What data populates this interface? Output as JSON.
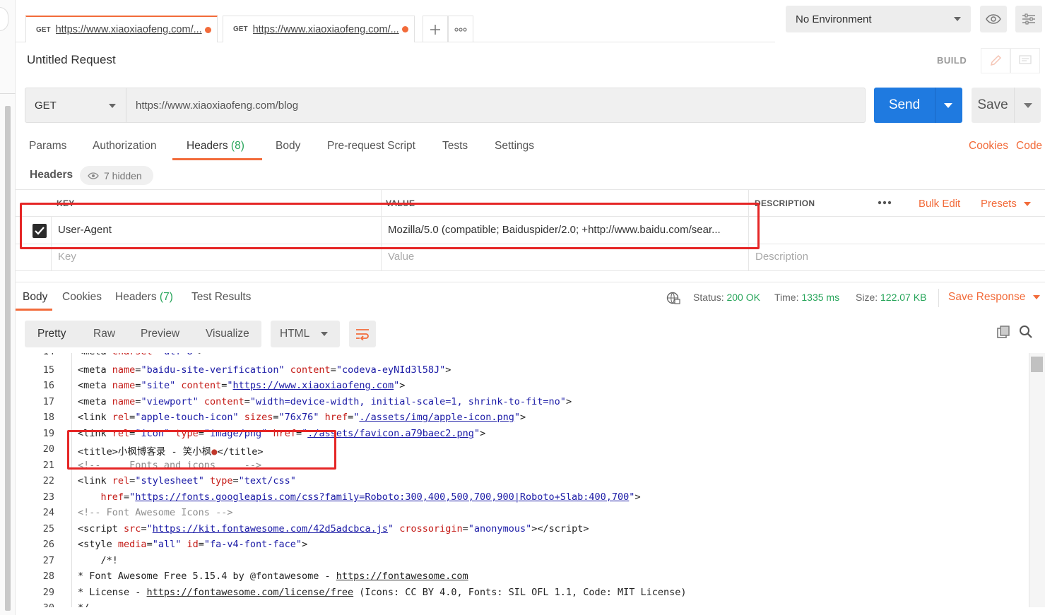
{
  "tabs": [
    {
      "method": "GET",
      "url": "https://www.xiaoxiaofeng.com/..."
    },
    {
      "method": "GET",
      "url": "https://www.xiaoxiaofeng.com/..."
    }
  ],
  "environment": {
    "selected": "No Environment"
  },
  "request": {
    "title": "Untitled Request",
    "mode": "BUILD",
    "method": "GET",
    "url": "https://www.xiaoxiaofeng.com/blog",
    "send_label": "Send",
    "save_label": "Save"
  },
  "request_tabs": {
    "params": "Params",
    "authorization": "Authorization",
    "headers": "Headers",
    "headers_count": "(8)",
    "body": "Body",
    "prerequest": "Pre-request Script",
    "tests": "Tests",
    "settings": "Settings",
    "cookies_link": "Cookies",
    "code_link": "Code"
  },
  "headers_section": {
    "label": "Headers",
    "hidden": "7 hidden",
    "col_key": "KEY",
    "col_value": "VALUE",
    "col_desc": "DESCRIPTION",
    "bulk_edit": "Bulk Edit",
    "presets": "Presets",
    "rows": [
      {
        "key": "User-Agent",
        "value": "Mozilla/5.0 (compatible; Baiduspider/2.0; +http://www.baidu.com/sear...",
        "checked": true
      }
    ],
    "placeholder_key": "Key",
    "placeholder_value": "Value",
    "placeholder_desc": "Description"
  },
  "response": {
    "tabs": {
      "body": "Body",
      "cookies": "Cookies",
      "headers": "Headers",
      "headers_count": "(7)",
      "test_results": "Test Results"
    },
    "status_label": "Status:",
    "status_value": "200 OK",
    "time_label": "Time:",
    "time_value": "1335 ms",
    "size_label": "Size:",
    "size_value": "122.07 KB",
    "save_response": "Save Response",
    "views": {
      "pretty": "Pretty",
      "raw": "Raw",
      "preview": "Preview",
      "visualize": "Visualize"
    },
    "format": "HTML"
  },
  "colors": {
    "accent": "#f26b3a",
    "primary": "#1f7ae0",
    "success": "#27a55a",
    "highlight": "#e52626"
  }
}
